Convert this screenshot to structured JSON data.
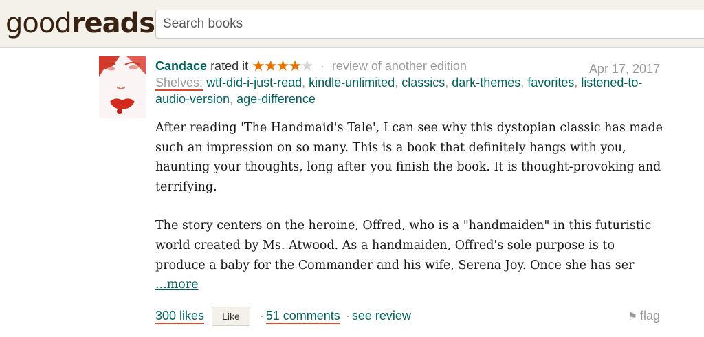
{
  "header": {
    "logo_part1": "good",
    "logo_part2": "reads",
    "search_placeholder": "Search books"
  },
  "review": {
    "user": "Candace",
    "rated_text": "rated it",
    "rating": 4,
    "rating_max": 5,
    "edition_text": "review of another edition",
    "date": "Apr 17, 2017",
    "shelves_label": "Shelves:",
    "shelves": [
      "wtf-did-i-just-read",
      "kindle-unlimited",
      "classics",
      "dark-themes",
      "favorites",
      "listened-to-audio-version",
      "age-difference"
    ],
    "paragraph1": "After reading 'The Handmaid's Tale', I can see why this dystopian classic has made such an impression on so many. This is a book that definitely hangs with you, haunting your thoughts, long after you finish the book. It is thought-provoking and terrifying.",
    "paragraph2": "The story centers on the heroine, Offred, who is a \"handmaiden\" in this futuristic world created by Ms. Atwood. As a handmaiden, Offred's sole purpose is to produce a baby for the Commander and his wife, Serena Joy. Once she has ser",
    "more_link": "...more"
  },
  "footer": {
    "likes": "300 likes",
    "like_button": "Like",
    "comments": "51 comments",
    "see_review": "see review",
    "flag": "flag"
  },
  "colors": {
    "link": "#00635d",
    "star": "#e87400",
    "header_bg": "#f4f1ea",
    "annotation": "#e0452e"
  }
}
